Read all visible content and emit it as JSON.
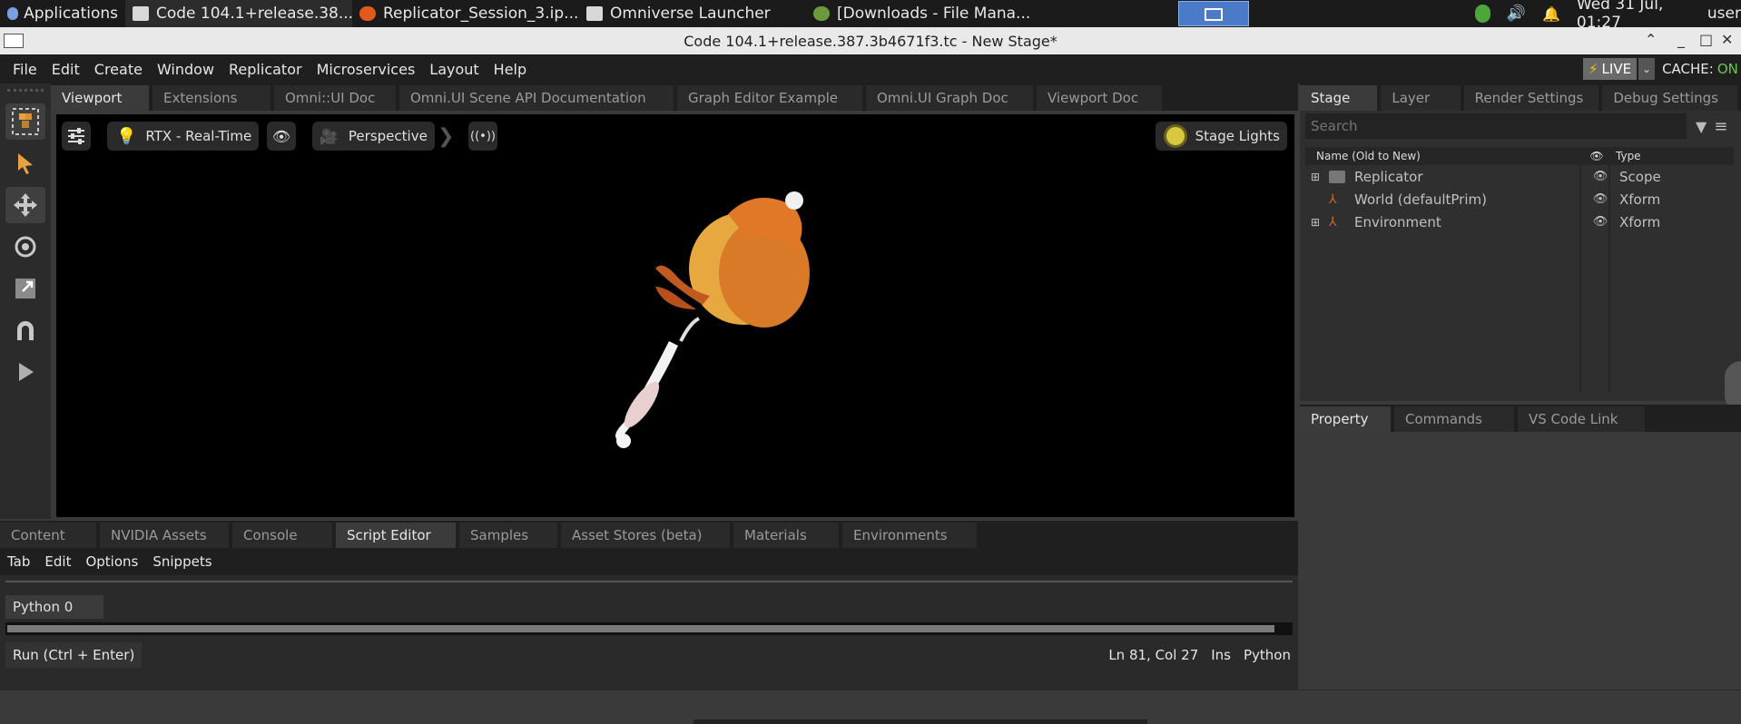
{
  "taskbar": {
    "apps_label": "Applications",
    "windows": [
      {
        "label": "Code 104.1+release.38...",
        "icon_color": "#d8d8d8"
      },
      {
        "label": "Replicator_Session_3.ip...",
        "icon_color": "#e05a1c"
      },
      {
        "label": "Omniverse Launcher",
        "icon_color": "#d8d8d8"
      },
      {
        "label": "[Downloads - File Mana...",
        "icon_color": "#6a9a3a"
      }
    ],
    "clock": "Wed 31 Jul, 01:27",
    "user": "user"
  },
  "window": {
    "title": "Code 104.1+release.387.3b4671f3.tc - New Stage*"
  },
  "menubar": {
    "items": [
      "File",
      "Edit",
      "Create",
      "Window",
      "Replicator",
      "Microservices",
      "Layout",
      "Help"
    ],
    "live_label": "LIVE",
    "cache_label": "CACHE:",
    "cache_value": "ON"
  },
  "viewport_tabs": [
    "Viewport",
    "Extensions",
    "Omni::UI Doc",
    "Omni.UI Scene API Documentation",
    "Graph Editor Example",
    "Omni.UI Graph Doc",
    "Viewport Doc"
  ],
  "viewport": {
    "renderer_label": "RTX - Real-Time",
    "camera_label": "Perspective",
    "lights_label": "Stage Lights"
  },
  "bottom_tabs": [
    "Content",
    "NVIDIA Assets",
    "Console",
    "Script Editor",
    "Samples",
    "Asset Stores (beta)",
    "Materials",
    "Environments"
  ],
  "script_editor": {
    "menu": [
      "Tab",
      "Edit",
      "Options",
      "Snippets"
    ],
    "session_tab": "Python 0",
    "run_label": "Run (Ctrl + Enter)",
    "status_position": "Ln 81, Col 27",
    "status_mode": "Ins",
    "status_lang": "Python"
  },
  "stage_tabs": [
    "Stage",
    "Layer",
    "Render Settings",
    "Debug Settings"
  ],
  "stage": {
    "search_placeholder": "Search",
    "col_name": "Name (Old to New)",
    "col_type": "Type",
    "rows": [
      {
        "name": "Replicator",
        "type": "Scope"
      },
      {
        "name": "World (defaultPrim)",
        "type": "Xform"
      },
      {
        "name": "Environment",
        "type": "Xform"
      }
    ]
  },
  "property_tabs": [
    "Property",
    "Commands",
    "VS Code Link"
  ],
  "colors": {
    "accent_live": "#e8c800",
    "cache_on": "#6ac84a",
    "tab_active": "#3b3b3b"
  }
}
